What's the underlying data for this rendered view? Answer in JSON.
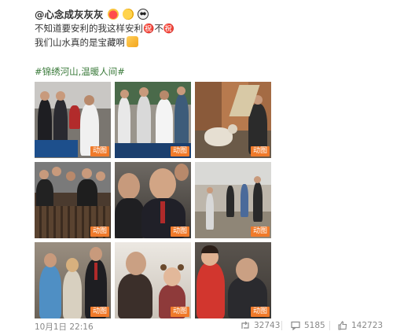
{
  "post": {
    "author": "@心念成灰灰灰",
    "author_emojis": [
      "heart-eyes-emoji",
      "cheers-emoji",
      "panda-emoji"
    ],
    "text_line1": "不知道要安利的我这样安利㊗️不㊗️",
    "text_line2": "我们山水真的是宝藏啊",
    "tags": "#锦绣河山,温暖人间#",
    "media_badge": "动图",
    "thumbnails": [
      {
        "name": "ping-pong-visit"
      },
      {
        "name": "ping-pong-table"
      },
      {
        "name": "sheep-farm"
      },
      {
        "name": "crowd-at-fence"
      },
      {
        "name": "smiling-leaders"
      },
      {
        "name": "village-walk"
      },
      {
        "name": "meeting-guests"
      },
      {
        "name": "eating-with-child"
      },
      {
        "name": "child-in-red"
      }
    ],
    "date": "10月1日 22:16",
    "reposts": "32743",
    "comments": "5185",
    "likes": "142723"
  },
  "colors": {
    "tag_green": "#3a7a3a",
    "badge_orange": "#f07a2a",
    "meta_gray": "#888888"
  }
}
